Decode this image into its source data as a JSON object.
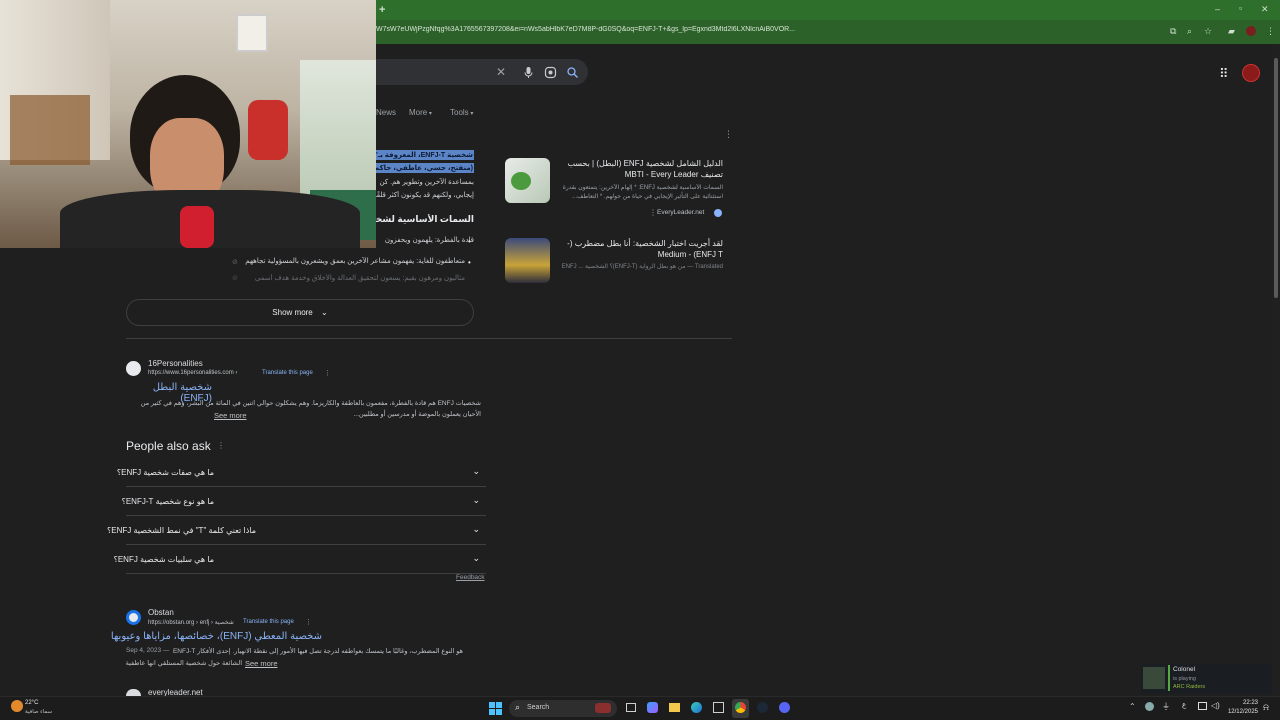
{
  "browser": {
    "new_tab_symbol": "+",
    "url": "W7sW7eUWjPzgNfqg%3A1765567397208&ei=nWs5abHlbK7eD7M8P-dG0SQ&oq=ENFJ-T+&gs_lp=Egxnd3Mtd2l6LXNlcnAiB0VOR...",
    "win_controls": [
      "–",
      "▫",
      "✕"
    ]
  },
  "search": {
    "query": ""
  },
  "tabs": {
    "news": "News",
    "more": "More",
    "tools": "Tools"
  },
  "snippet": {
    "highlight_1": "شخصية ENFJ-T، المعروفة بـ\"البطل\"",
    "highlight_2": "(منفتح، حسي، عاطفي، حاكم) مع ج",
    "line_3": "بمساعدة الآخرين وتطوير هم. كن",
    "line_4": "إيجابي، ولكنهم قد يكونون أكثر قلقًا",
    "heading": "السمات الأساسية لشخصية T",
    "bullet_1": "قادة بالفطرة: يلهمون ويحفزون",
    "bullet_2": "متعاطفون للغاية: يفهمون مشاعر الآخرين بعمق ويشعرون بالمسؤولية تجاههم",
    "bullet_3": "مثاليون ومرهون بقيم: يسعون لتحقيق العدالة والأخلاق وخدمة هدف أسمى",
    "show_more": "Show more"
  },
  "side_results": [
    {
      "title": "الدليل الشامل لشخصية ENFJ (البطل) | بحسب تصنيف MBTI - Every Leader",
      "desc": "السمات الأساسية لشخصية ENFJ: * إلهام الآخرين: يتمتعون بقدرة استثنائية على التأثير الإيجابي في حياة من حولهم. * التعاطف...",
      "source": "EveryLeader.net"
    },
    {
      "title": "لقد أجريت اختبار الشخصية: أنا بطل مضطرب (-ENFJ T) - Medium",
      "desc": "Translated — من هو بطل الرواية (ENFJ-T)؟ الشخصية ... ENFJ",
      "source": ""
    }
  ],
  "result_16p": {
    "site": "16Personalities",
    "url": "https://www.16personalities.com ›",
    "translate": "Translate this page",
    "title": "شخصية البطل (ENFJ)",
    "snippet": "شخصيات ENFJ هم قادة بالفطرة، مفعمون بالعاطفة والكاريزما. وهم يشكلون حوالي اثنين في المائة من البشر، وهم في كثير من الأحيان يعملون بالموضة أو مدرسين أو مطلبين...",
    "see_more": "See more"
  },
  "paa": {
    "heading": "People also ask",
    "questions": [
      "ما هي صفات شخصية ENFJ؟",
      "ما هو نوع شخصية ENFJ-T؟",
      "ماذا تعني كلمة \"T\" في نمط الشخصية ENFJ؟",
      "ما هي سلبيات شخصية ENFJ؟"
    ],
    "feedback": "Feedback"
  },
  "result_obstan": {
    "site": "Obstan",
    "url": "https://obstan.org › enfj › شخصية",
    "translate": "Translate this page",
    "title": "شخصية المعطي (ENFJ)، خصائصها، مزاياها وعيوبها",
    "date": "Sep 4, 2023 —",
    "snippet": "هو النوع المضطرب، وغالبًا ما يتمسك بعواطفه لدرجة تصل فيها الأمور إلى نقطة الانهيار. إحدى الأفكار ENFJ-T",
    "snippet2": "الشائعة حول شخصية المستلقي انها عاطفية",
    "see_more": "See more"
  },
  "result_everyleader": {
    "site": "everyleader.net"
  },
  "steam_notice": {
    "name": "Colonel",
    "status": "is playing",
    "game": "ARC Raiders"
  },
  "taskbar": {
    "weather_temp": "22°C",
    "weather_desc": "سماء صافية",
    "search_label": "Search",
    "time": "22:23",
    "date": "12/12/2025"
  }
}
